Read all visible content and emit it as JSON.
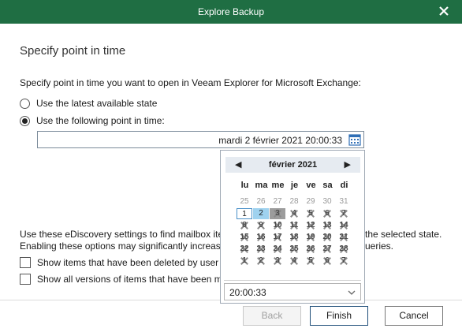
{
  "window": {
    "title": "Explore Backup"
  },
  "page": {
    "heading": "Specify point in time",
    "instruction": "Specify point in time you want to open in Veeam Explorer for Microsoft Exchange:"
  },
  "options": {
    "latest_label": "Use the latest available state",
    "point_label": "Use the following point in time:",
    "selected": "point"
  },
  "datetime": {
    "value": "mardi 2 février 2021 20:00:33"
  },
  "calendar": {
    "month_label": "février 2021",
    "prev": "◀",
    "next": "▶",
    "weekdays": [
      "lu",
      "ma",
      "me",
      "je",
      "ve",
      "sa",
      "di"
    ],
    "weeks": [
      [
        "25",
        "26",
        "27",
        "28",
        "29",
        "30",
        "31"
      ],
      [
        "1",
        "2",
        "3",
        "4",
        "5",
        "6",
        "7"
      ],
      [
        "8",
        "9",
        "10",
        "11",
        "12",
        "13",
        "14"
      ],
      [
        "15",
        "16",
        "17",
        "18",
        "19",
        "20",
        "21"
      ],
      [
        "22",
        "23",
        "24",
        "25",
        "26",
        "27",
        "28"
      ],
      [
        "1",
        "2",
        "3",
        "4",
        "5",
        "6",
        "7"
      ]
    ],
    "time": "20:00:33"
  },
  "ediscovery": {
    "text_line1": "Use these eDiscovery settings to find mailbox ite",
    "text_line1_end": "the selected state.",
    "text_line2": "Enabling these options may significantly increas",
    "text_line2_end": "ueries.",
    "deleted_label": "Show items that have been deleted by user",
    "versions_label": "Show all versions of items that have been m"
  },
  "buttons": {
    "back": "Back",
    "finish": "Finish",
    "cancel": "Cancel"
  },
  "colors": {
    "titlebar": "#1f6e43",
    "calendar_selected": "#9fd2ef"
  }
}
